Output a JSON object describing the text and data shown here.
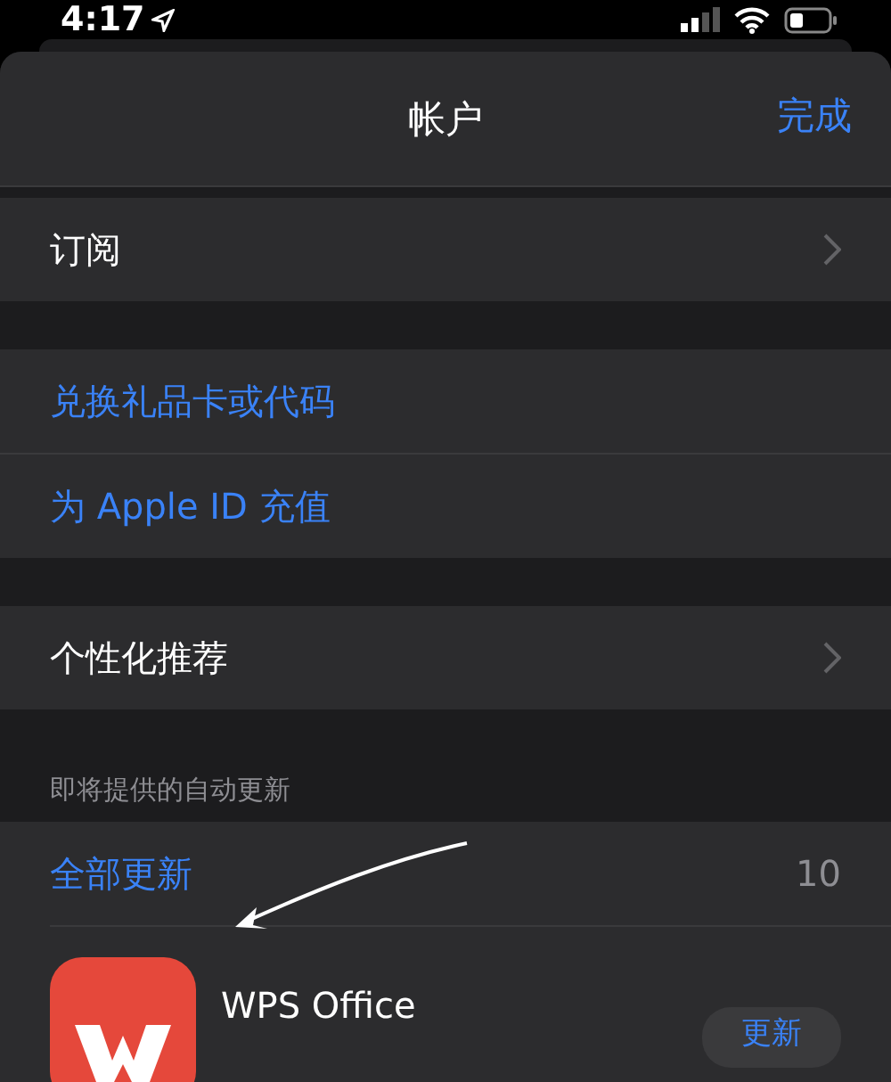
{
  "status_bar": {
    "time": "4:17"
  },
  "header": {
    "title": "帐户",
    "done": "完成"
  },
  "groups": [
    {
      "rows": [
        {
          "label": "订阅",
          "kind": "nav"
        }
      ]
    },
    {
      "rows": [
        {
          "label": "兑换礼品卡或代码",
          "kind": "link"
        },
        {
          "label": "为 Apple ID 充值",
          "kind": "link"
        }
      ]
    },
    {
      "rows": [
        {
          "label": "个性化推荐",
          "kind": "nav"
        }
      ]
    }
  ],
  "updates": {
    "header": "即将提供的自动更新",
    "update_all": "全部更新",
    "count": "10",
    "apps": [
      {
        "name": "WPS Office",
        "button": "更新"
      }
    ]
  }
}
